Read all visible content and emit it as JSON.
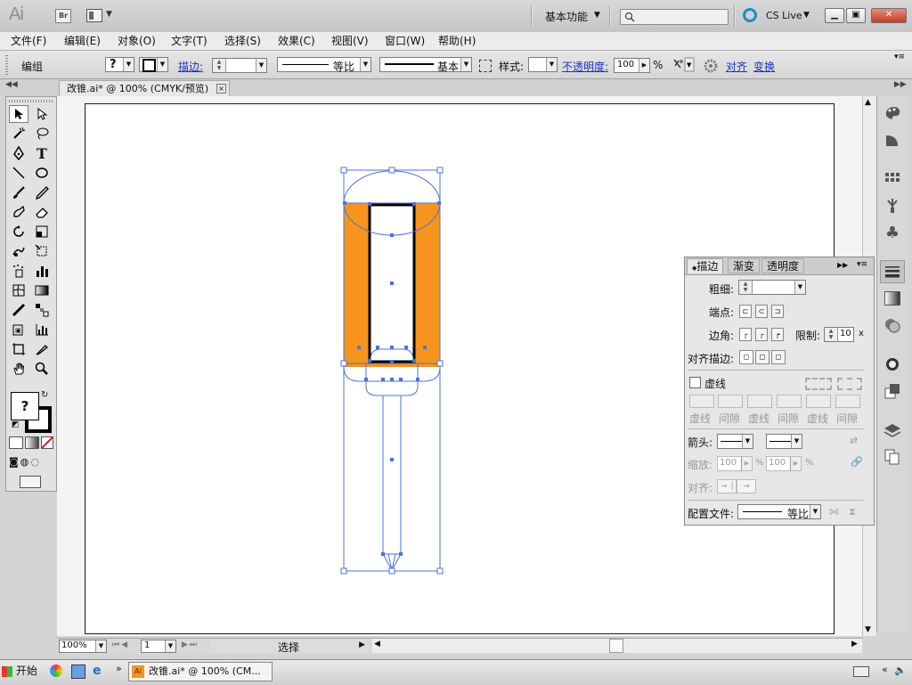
{
  "app": {
    "logo": "Ai",
    "bridge_label": "Br",
    "workspace": "基本功能",
    "cslive": "CS Live"
  },
  "window_buttons": {
    "minimize": "▁",
    "restore": "▣",
    "close": "✕"
  },
  "menu": [
    "文件(F)",
    "编辑(E)",
    "对象(O)",
    "文字(T)",
    "选择(S)",
    "效果(C)",
    "视图(V)",
    "窗口(W)",
    "帮助(H)"
  ],
  "control_bar": {
    "group_label": "编组",
    "fill_swatch": "?",
    "stroke_label": "描边:",
    "profile_label": "等比",
    "brush_label": "基本",
    "style_label": "样式:",
    "opacity_label": "不透明度:",
    "opacity_value": "100",
    "opacity_unit": "%",
    "align_label": "对齐",
    "transform_label": "变换"
  },
  "document": {
    "tab_title": "改锥.ai* @ 100% (CMYK/预览)",
    "close": "×"
  },
  "tools": {
    "fill_label": "?"
  },
  "stroke_panel": {
    "tabs": [
      "描边",
      "渐变",
      "透明度"
    ],
    "weight_label": "粗细:",
    "cap_label": "端点:",
    "corner_label": "边角:",
    "limit_label": "限制:",
    "limit_value": "10",
    "limit_unit": "x",
    "align_label": "对齐描边:",
    "dashed_label": "虚线",
    "dash_labels": [
      "虚线",
      "间隙",
      "虚线",
      "间隙",
      "虚线",
      "间隙"
    ],
    "arrow_label": "箭头:",
    "scale_label": "缩放:",
    "scale_values": [
      "100",
      "100"
    ],
    "scale_unit": "%",
    "align2_label": "对齐:",
    "profile_label": "配置文件:",
    "profile_value": "等比"
  },
  "status": {
    "zoom": "100%",
    "page": "1",
    "mode": "选择"
  },
  "taskbar": {
    "start": "开始",
    "task": "改锥.ai* @ 100% (CM..."
  },
  "colors": {
    "orange": "#f7941d",
    "selection": "#4b73d8",
    "cslive": "#1c8ec9"
  },
  "icons": [
    "search-icon",
    "selection-tool-icon",
    "direct-select-icon",
    "magic-wand-icon",
    "lasso-icon",
    "pen-icon",
    "type-icon",
    "line-icon",
    "ellipse-icon",
    "brush-icon",
    "pencil-icon",
    "blob-brush-icon",
    "eraser-icon",
    "rotate-icon",
    "scale-icon",
    "warp-icon",
    "free-transform-icon",
    "symbol-sprayer-icon",
    "graph-icon",
    "mesh-icon",
    "gradient-icon",
    "eyedropper-icon",
    "blend-icon",
    "slice-icon",
    "column-graph-icon",
    "artboard-icon",
    "knife-icon",
    "hand-icon",
    "zoom-icon"
  ]
}
